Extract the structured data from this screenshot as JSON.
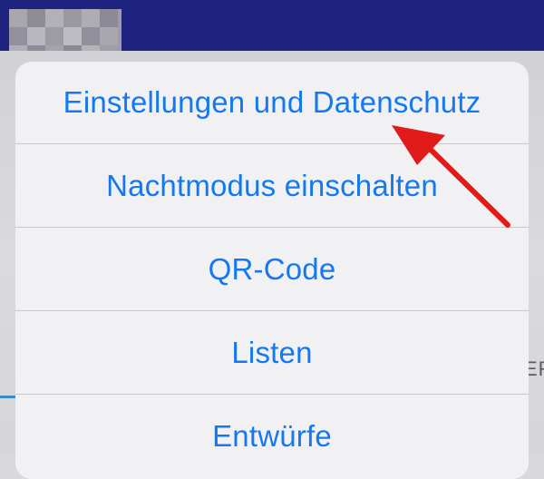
{
  "colors": {
    "top_bar": "#1f2380",
    "action_text": "#1479f0",
    "sheet_background": "#f1f1f3",
    "separator": "#c8c8cc",
    "arrow": "#e11a1a"
  },
  "background": {
    "tab_label_fragment": "ER"
  },
  "action_sheet": {
    "items": [
      {
        "label": "Einstellungen und Datenschutz"
      },
      {
        "label": "Nachtmodus einschalten"
      },
      {
        "label": "QR-Code"
      },
      {
        "label": "Listen"
      },
      {
        "label": "Entwürfe"
      }
    ]
  },
  "annotation": {
    "icon": "red-arrow-icon",
    "points_to": "Einstellungen und Datenschutz"
  }
}
